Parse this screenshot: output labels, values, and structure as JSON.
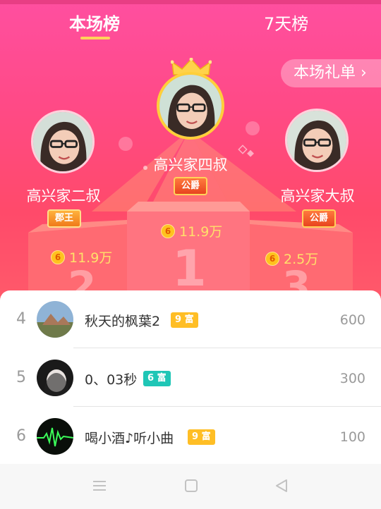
{
  "tabs": {
    "current": "本场榜",
    "week": "7天榜"
  },
  "gift_list_button": "本场礼单 ›",
  "podium": {
    "first": {
      "name": "高兴家四叔",
      "badge": "公爵",
      "score": "11.9万",
      "place": "1"
    },
    "second": {
      "name": "高兴家二叔",
      "badge": "郡王",
      "score": "11.9万",
      "place": "2"
    },
    "third": {
      "name": "高兴家大叔",
      "badge": "公爵",
      "score": "2.5万",
      "place": "3"
    }
  },
  "ranking": [
    {
      "rank": "4",
      "name": "秋天的枫葉2",
      "level": "9 富",
      "points": "600",
      "level_color": "gold"
    },
    {
      "rank": "5",
      "name": "0、03秒",
      "level": "6 富",
      "points": "300",
      "level_color": "teal"
    },
    {
      "rank": "6",
      "name": "喝小酒♪听小曲",
      "level": "9 富",
      "points": "100",
      "level_color": "gold"
    }
  ],
  "icons": {
    "coin": "coin-icon",
    "crown": "crown-icon",
    "nav": [
      "menu-icon",
      "home-square-icon",
      "back-triangle-icon"
    ]
  },
  "colors": {
    "hero": "#ff4a86",
    "coin": "#ffc21e",
    "score": "#ffe16a",
    "tab_underline": "#ffd35a",
    "level_gold": "#ffbe25",
    "level_teal": "#1fc6b6"
  },
  "coin_glyph": "6"
}
